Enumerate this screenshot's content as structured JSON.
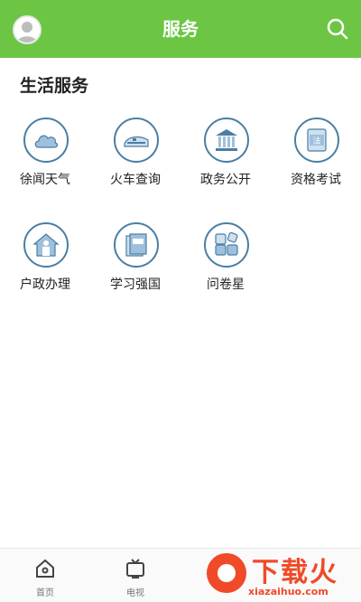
{
  "header": {
    "title": "服务",
    "avatar_icon": "user-avatar-icon",
    "search_icon": "search-icon",
    "bg_color": "#6cc644"
  },
  "section": {
    "title": "生活服务"
  },
  "services": [
    {
      "label": "徐闻天气",
      "icon": "cloud-icon"
    },
    {
      "label": "火车查询",
      "icon": "train-icon"
    },
    {
      "label": "政务公开",
      "icon": "government-building-icon"
    },
    {
      "label": "资格考试",
      "icon": "law-book-icon"
    },
    {
      "label": "户政办理",
      "icon": "household-house-icon"
    },
    {
      "label": "学习强国",
      "icon": "study-book-icon"
    },
    {
      "label": "问卷星",
      "icon": "questionnaire-grid-icon"
    }
  ],
  "tabbar": [
    {
      "label": "首页",
      "icon": "home-icon"
    },
    {
      "label": "电视",
      "icon": "tv-icon"
    }
  ],
  "watermark": {
    "text": "下载火",
    "url": "xiazaihuo.com"
  }
}
